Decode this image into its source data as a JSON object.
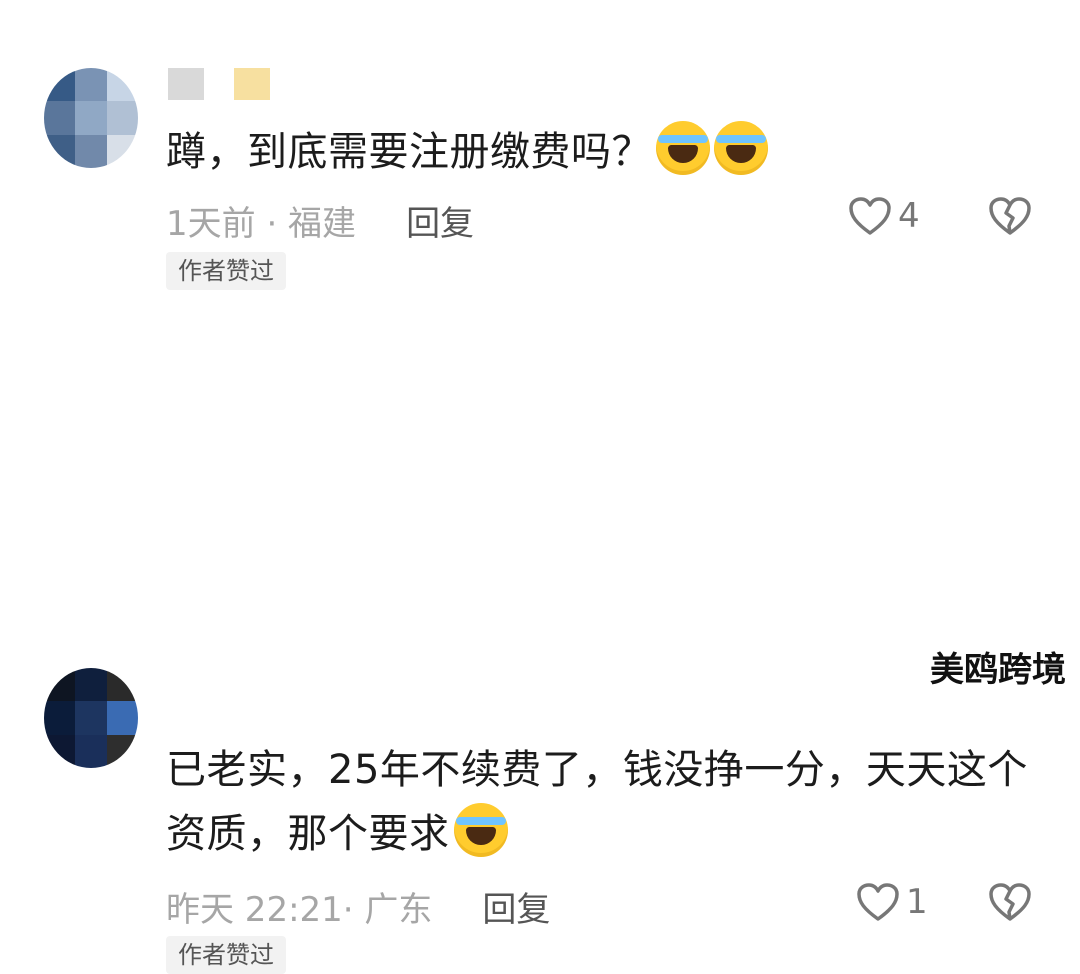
{
  "comments": [
    {
      "text_before": "蹲，到底需要注册缴费吗？",
      "emoji": [
        "rolling-laughing-emoji",
        "rolling-laughing-emoji"
      ],
      "time_location": "1天前 · 福建",
      "reply_label": "回复",
      "like_count": "4",
      "author_badge": "作者赞过",
      "avatar_colors": [
        "#365a86",
        "#7a93b4",
        "#c7d5e6",
        "#5a769b",
        "#90a8c5",
        "#b0c0d4",
        "#3f5f87",
        "#7189aa",
        "#d8dfe8"
      ],
      "username_colors": [
        "#d9d9d9",
        "#f7e0a0"
      ]
    },
    {
      "text_line1": "已老实，25年不续费了，钱没挣一分，天天这个",
      "text_line2": "资质，那个要求",
      "emoji": [
        "crying-emoji"
      ],
      "time_location": "昨天 22:21· 广东",
      "reply_label": "回复",
      "like_count": "1",
      "author_badge": "作者赞过",
      "avatar_colors": [
        "#0e1522",
        "#0f1f3d",
        "#2a2a2a",
        "#0b1c3a",
        "#1d3560",
        "#3a6bb3",
        "#0d1833",
        "#1a2f5a",
        "#2e2e2e"
      ]
    }
  ],
  "watermark": "美鸥跨境"
}
